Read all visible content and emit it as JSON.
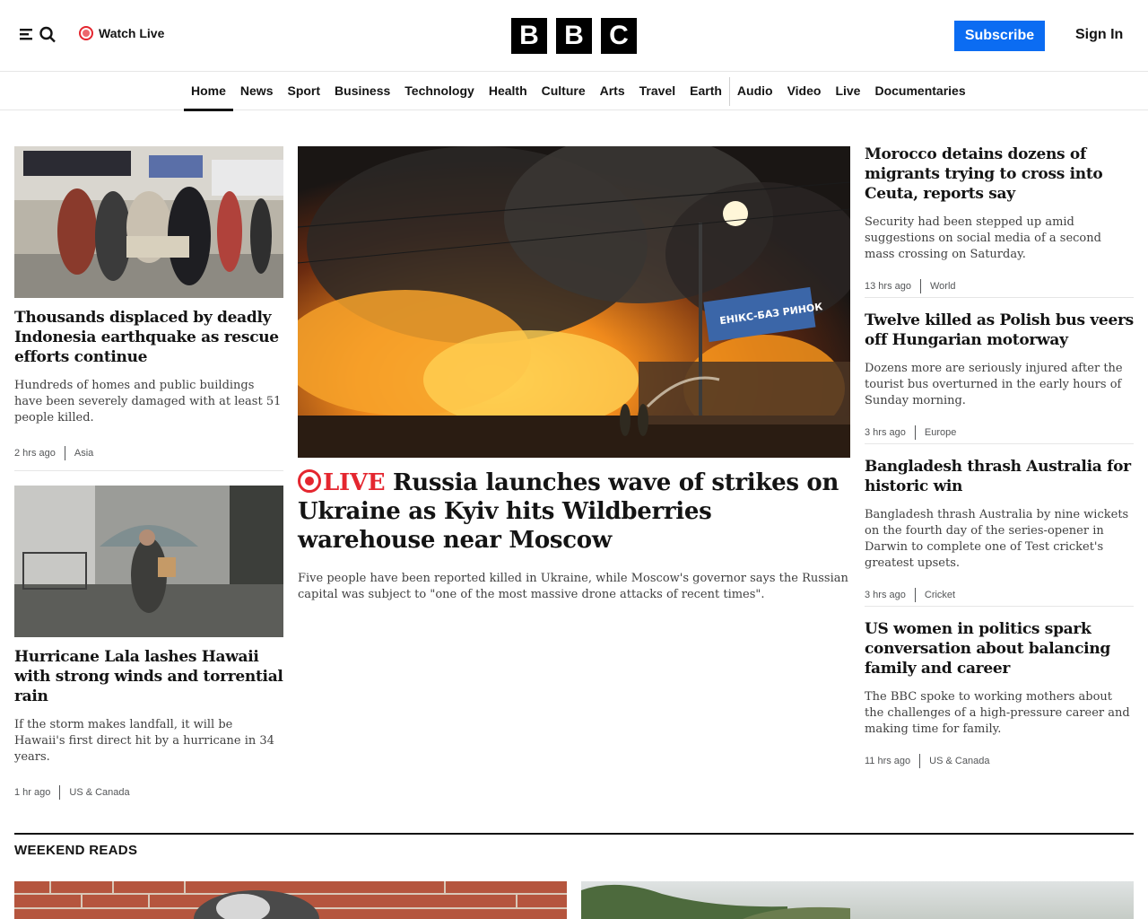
{
  "header": {
    "watch_live_label": "Watch Live",
    "logo_letters": [
      "B",
      "B",
      "C"
    ],
    "subscribe_label": "Subscribe",
    "signin_label": "Sign In"
  },
  "nav": {
    "items": [
      {
        "label": "Home",
        "active": true
      },
      {
        "label": "News"
      },
      {
        "label": "Sport"
      },
      {
        "label": "Business"
      },
      {
        "label": "Technology"
      },
      {
        "label": "Health"
      },
      {
        "label": "Culture"
      },
      {
        "label": "Arts"
      },
      {
        "label": "Travel"
      },
      {
        "label": "Earth"
      },
      {
        "label": "Audio"
      },
      {
        "label": "Video"
      },
      {
        "label": "Live"
      },
      {
        "label": "Documentaries"
      }
    ]
  },
  "left_stories": [
    {
      "headline": "Thousands displaced by deadly Indonesia earthquake as rescue efforts continue",
      "summary": "Hundreds of homes and public buildings have been severely damaged with at least 51 people killed.",
      "time": "2 hrs ago",
      "category": "Asia"
    },
    {
      "headline": "Hurricane Lala lashes Hawaii with strong winds and torrential rain",
      "summary": "If the storm makes landfall, it will be Hawaii's first direct hit by a hurricane in 34 years.",
      "time": "1 hr ago",
      "category": "US & Canada"
    }
  ],
  "main_story": {
    "live_label": "LIVE",
    "headline": "Russia launches wave of strikes on Ukraine as Kyiv hits Wildberries warehouse near Moscow",
    "summary": "Five people have been reported killed in Ukraine, while Moscow's governor says the Russian capital was subject to \"one of the most massive drone attacks of recent times\".",
    "sign_text": "ЕНІКС-БАЗ РИНОК"
  },
  "right_stories": [
    {
      "headline": "Morocco detains dozens of migrants trying to cross into Ceuta, reports say",
      "summary": "Security had been stepped up amid suggestions on social media of a second mass crossing on Saturday.",
      "time": "13 hrs ago",
      "category": "World"
    },
    {
      "headline": "Twelve killed as Polish bus veers off Hungarian motorway",
      "summary": "Dozens more are seriously injured after the tourist bus overturned in the early hours of Sunday morning.",
      "time": "3 hrs ago",
      "category": "Europe"
    },
    {
      "headline": "Bangladesh thrash Australia for historic win",
      "summary": "Bangladesh thrash Australia by nine wickets on the fourth day of the series-opener in Darwin to complete one of Test cricket's greatest upsets.",
      "time": "3 hrs ago",
      "category": "Cricket"
    },
    {
      "headline": "US women in politics spark conversation about balancing family and career",
      "summary": "The BBC spoke to working mothers about the challenges of a high-pressure career and making time for family.",
      "time": "11 hrs ago",
      "category": "US & Canada"
    }
  ],
  "weekend": {
    "title": "WEEKEND READS"
  },
  "colors": {
    "accent_blue": "#0b6cf2",
    "live_red": "#e4262f",
    "text": "#141414"
  }
}
